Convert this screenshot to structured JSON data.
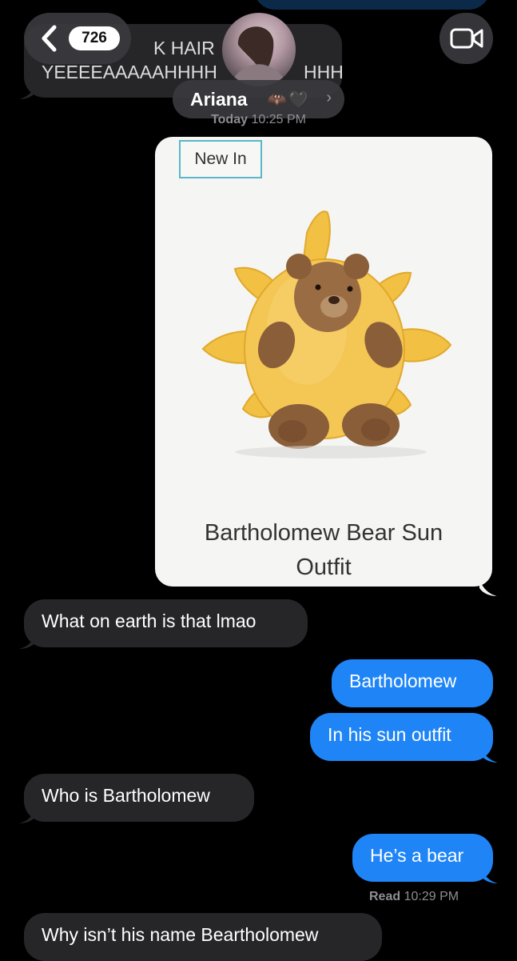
{
  "header": {
    "unread_count": "726",
    "contact_name": "Ariana",
    "contact_emoji": "🦇🖤",
    "icons": [
      "back-chevron-icon",
      "video-camera-icon",
      "chevron-right-icon"
    ]
  },
  "top_message": {
    "line1": "K HAIR",
    "line2": "YEEEEAAAAAHHHH",
    "line3": "HHH"
  },
  "timestamp": {
    "day": "Today",
    "time": "10:25 PM"
  },
  "product_card": {
    "tag": "New In",
    "title_line1": "Bartholomew Bear Sun",
    "title_line2": "Outfit",
    "image": "plush-bear-in-sun-costume"
  },
  "messages": [
    {
      "direction": "received",
      "text": "What on earth is that lmao"
    },
    {
      "direction": "sent",
      "text": "Bartholomew"
    },
    {
      "direction": "sent",
      "text": "In his sun outfit"
    },
    {
      "direction": "received",
      "text": "Who is Bartholomew"
    },
    {
      "direction": "sent",
      "text": "He’s a bear"
    },
    {
      "direction": "received",
      "text": "Why isn’t his name Beartholomew"
    }
  ],
  "read_receipt": {
    "label": "Read",
    "time": "10:29 PM"
  },
  "colors": {
    "sent": "#1f85f7",
    "received": "#262629",
    "background": "#000000",
    "tag_border": "#5bb7c8"
  }
}
